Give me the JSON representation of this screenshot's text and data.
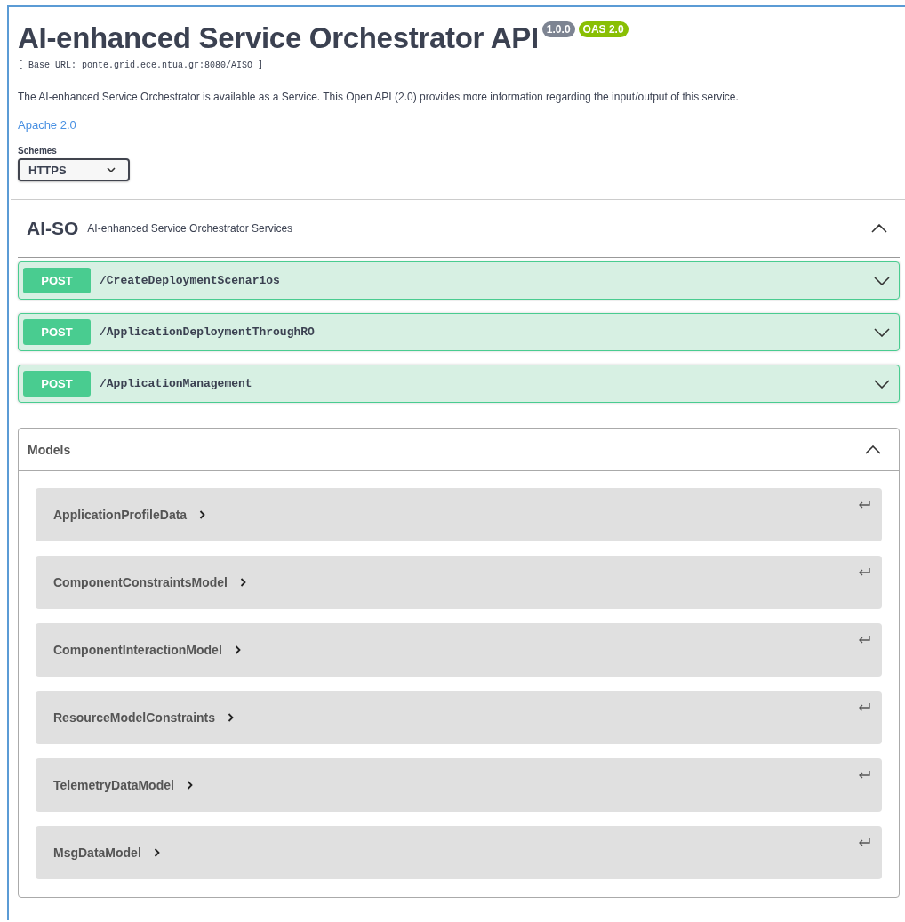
{
  "info": {
    "title": "AI-enhanced Service Orchestrator API",
    "version": "1.0.0",
    "spec_badge": "OAS 2.0",
    "base_url": "[ Base URL: ponte.grid.ece.ntua.gr:8080/AISO ]",
    "description": "The AI-enhanced Service Orchestrator is available as a Service. This Open API (2.0) provides more information regarding the input/output of this service.",
    "license": "Apache 2.0"
  },
  "schemes": {
    "label": "Schemes",
    "value": "HTTPS"
  },
  "tag": {
    "name": "AI-SO",
    "description": "AI-enhanced Service Orchestrator Services",
    "expanded": true,
    "operations": [
      {
        "method": "POST",
        "path": "/CreateDeploymentScenarios",
        "expanded": false
      },
      {
        "method": "POST",
        "path": "/ApplicationDeploymentThroughRO",
        "expanded": false
      },
      {
        "method": "POST",
        "path": "/ApplicationManagement",
        "expanded": false
      }
    ]
  },
  "models": {
    "title": "Models",
    "expanded": true,
    "items": [
      {
        "name": "ApplicationProfileData",
        "expanded": false
      },
      {
        "name": "ComponentConstraintsModel",
        "expanded": false
      },
      {
        "name": "ComponentInteractionModel",
        "expanded": false
      },
      {
        "name": "ResourceModelConstraints",
        "expanded": false
      },
      {
        "name": "TelemetryDataModel",
        "expanded": false
      },
      {
        "name": "MsgDataModel",
        "expanded": false
      }
    ]
  }
}
